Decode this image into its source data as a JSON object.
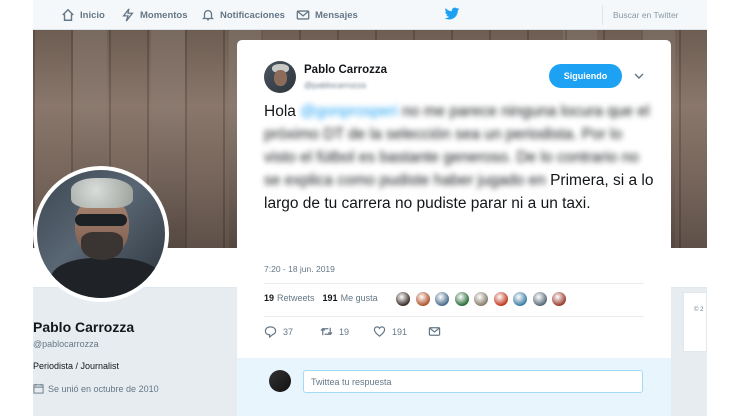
{
  "nav": {
    "inicio": "Inicio",
    "momentos": "Momentos",
    "notificaciones": "Notificaciones",
    "mensajes": "Mensajes",
    "search_placeholder": "Buscar en Twitter"
  },
  "profile": {
    "name": "Pablo Carrozza",
    "handle": "@pablocarrozza",
    "bio": "Periodista / Journalist",
    "joined": "Se unió en octubre de 2010",
    "side_card_text": "© 2"
  },
  "tweet": {
    "author_name": "Pablo Carrozza",
    "author_handle": "@pablocarrozza",
    "follow_label": "Siguiendo",
    "text_intro": "Hola ",
    "mention": "@gonprosperi",
    "text_blurred": " no me parece ninguna locura que el próximo DT de la selección sea un periodista. Por lo visto el fútbol es bastante generoso. De lo contrario no se explica como pudiste haber jugado en",
    "text_clear": " Primera, si a lo largo de tu carrera no pudiste parar ni a un taxi.",
    "timestamp": "7:20 - 18 jun. 2019",
    "retweets_count": "19",
    "retweets_label": "Retweets",
    "likes_count": "191",
    "likes_label": "Me gusta",
    "likers_colors": [
      "#3b2f2a",
      "#b0542c",
      "#4a6d8c",
      "#2e6f3c",
      "#8a7d6e",
      "#c23b22",
      "#3f7fa6",
      "#5a6b7a",
      "#9a3d2f"
    ],
    "reply_count": "37",
    "retweet_action_count": "19",
    "like_action_count": "191",
    "reply_placeholder": "Twittea tu respuesta"
  }
}
